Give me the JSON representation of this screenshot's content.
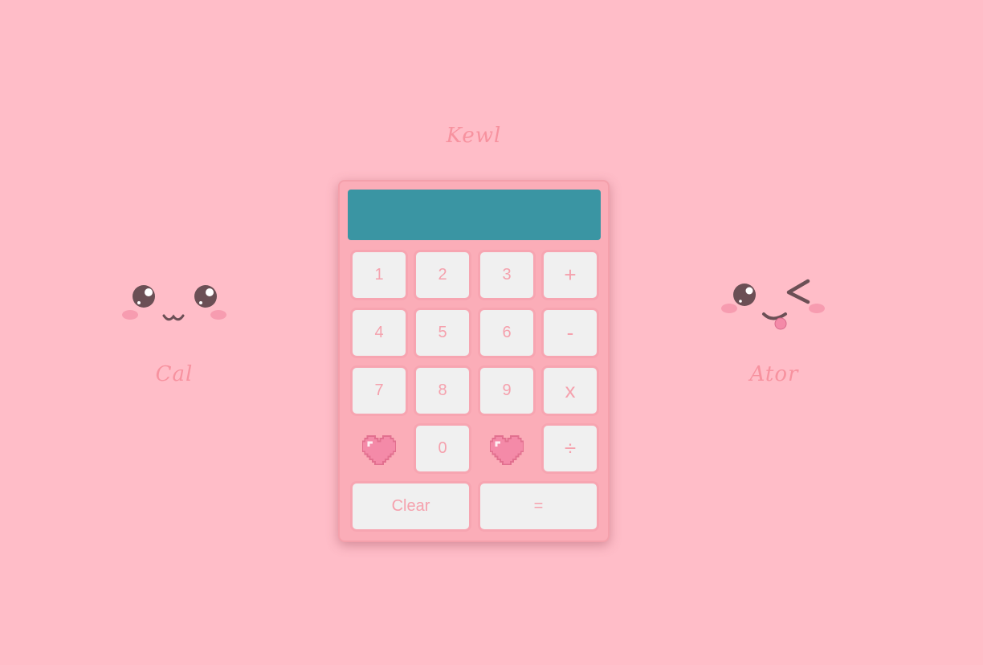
{
  "header": {
    "title": "Kewl"
  },
  "mascots": {
    "left": {
      "name": "Cal",
      "icon": "happy-face-icon"
    },
    "right": {
      "name": "Ator",
      "icon": "winking-face-icon"
    }
  },
  "calculator": {
    "display_value": "",
    "keys": {
      "k1": "1",
      "k2": "2",
      "k3": "3",
      "plus": "+",
      "k4": "4",
      "k5": "5",
      "k6": "6",
      "minus": "-",
      "k7": "7",
      "k8": "8",
      "k9": "9",
      "multiply": "x",
      "k0": "0",
      "divide": "÷",
      "clear": "Clear",
      "equals": "="
    },
    "decorations": [
      "pixel-heart-icon",
      "pixel-heart-icon"
    ]
  },
  "colors": {
    "background": "#ffbdc8",
    "calculator_body": "#fbadb8",
    "display": "#3a95a3",
    "key_face": "#f0f0f0",
    "key_text": "#f5a1ad",
    "script_text": "#f7929f"
  }
}
